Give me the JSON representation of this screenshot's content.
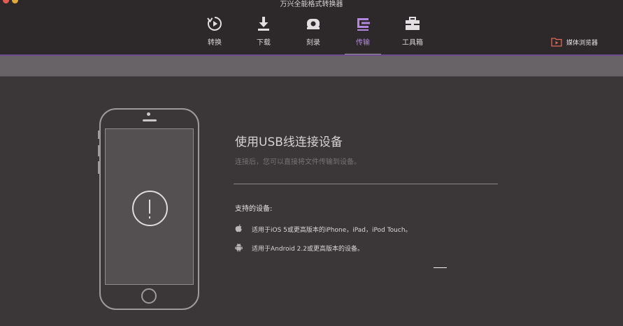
{
  "window": {
    "title": "万兴全能格式转换器"
  },
  "toolbar": {
    "tabs": [
      {
        "label": "转换",
        "icon": "convert-icon"
      },
      {
        "label": "下载",
        "icon": "download-icon"
      },
      {
        "label": "刻录",
        "icon": "burn-disc-icon"
      },
      {
        "label": "传输",
        "icon": "transfer-icon"
      },
      {
        "label": "工具箱",
        "icon": "toolbox-icon"
      }
    ],
    "active_tab": "传输",
    "media_browser": {
      "label": "媒体浏览器",
      "icon": "media-browser-icon"
    }
  },
  "main": {
    "heading": "使用USB线连接设备",
    "subtext": "连接后，您可以直接将文件传输到设备。",
    "supported_title": "支持的设备:",
    "devices": [
      {
        "icon": "apple-icon",
        "text": "适用于iOS 5或更高版本的iPhone，iPad，iPod Touch。"
      },
      {
        "icon": "android-icon",
        "text": "适用于Android 2.2或更高版本的设备。"
      }
    ]
  },
  "colors": {
    "accent": "#b487de",
    "accent_line": "#6f4a8f",
    "background": "#3b3738",
    "toolbar": "#2d292b",
    "subbar": "#676367"
  }
}
